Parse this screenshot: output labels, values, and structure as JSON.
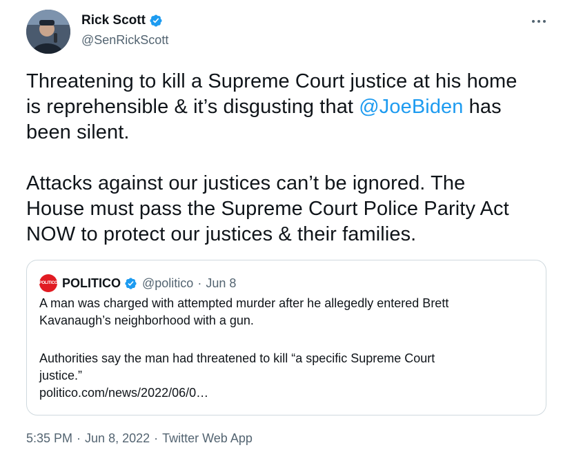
{
  "author": {
    "display_name": "Rick Scott",
    "handle": "@SenRickScott",
    "verified": true
  },
  "tweet": {
    "line1": "Threatening to kill a Supreme Court justice at his home",
    "line2_prefix": "is reprehensible & it’s disgusting that ",
    "mention": "@JoeBiden",
    "line2_suffix": " has",
    "line3": "been silent.",
    "para2_line1": "Attacks against our justices can’t be ignored. The",
    "para2_line2": "House must pass the Supreme Court Police Parity Act",
    "para2_line3": "NOW to protect our justices & their families."
  },
  "quote": {
    "avatar_text": "POLITICO",
    "name": "POLITICO",
    "handle": "@politico",
    "separator": "·",
    "date": "Jun 8",
    "text_line1": "A man was charged with attempted murder after he allegedly entered Brett",
    "text_line2": "Kavanaugh’s neighborhood with a gun.",
    "text_line3": "Authorities say the man had threatened to kill “a specific Supreme Court",
    "text_line4": "justice.”",
    "link": "politico.com/news/2022/06/0…"
  },
  "meta": {
    "time": "5:35 PM",
    "dot1": "·",
    "date": "Jun 8, 2022",
    "dot2": "·",
    "source": "Twitter Web App"
  },
  "colors": {
    "link": "#1d9bf0",
    "verified": "#1d9bf0",
    "secondary_text": "#536471",
    "border": "#cfd9de",
    "politico_red": "#e11b22"
  },
  "icons": {
    "verified": "verified-badge-icon",
    "more": "more-options-icon"
  }
}
